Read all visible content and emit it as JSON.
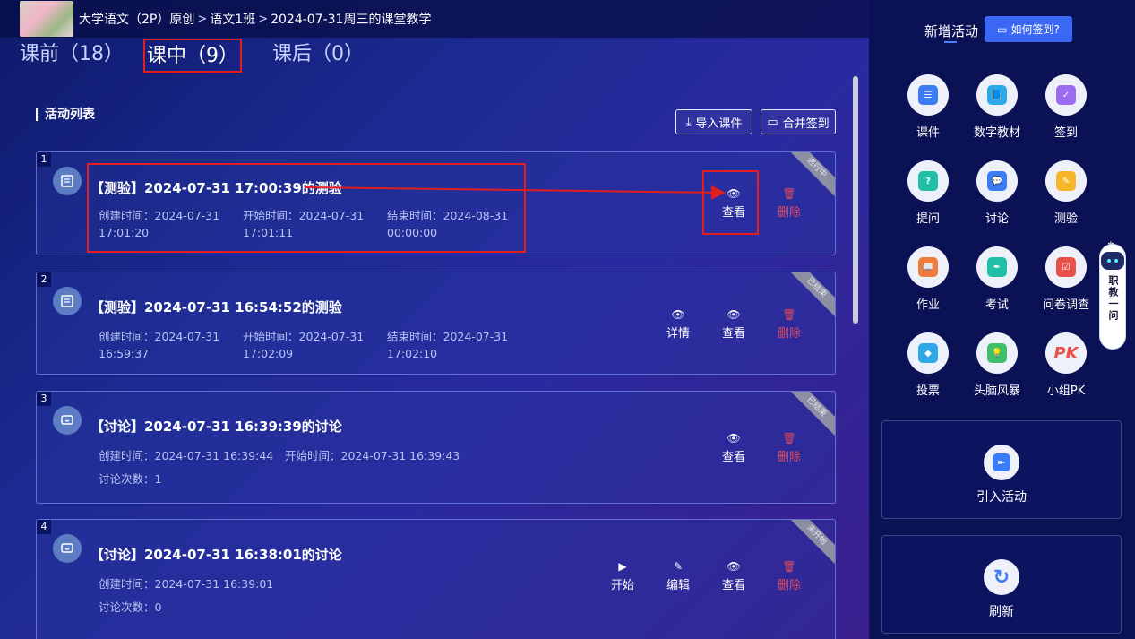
{
  "breadcrumb": {
    "course": "大学语文（2P）原创",
    "class": "语文1班",
    "lesson": "2024-07-31周三的课堂教学",
    "sep": ">"
  },
  "tabs": [
    {
      "label": "课前（18）"
    },
    {
      "label": "课中（9）"
    },
    {
      "label": "课后（0）"
    }
  ],
  "section_title": "活动列表",
  "header_buttons": {
    "import": "导入课件",
    "merge": "合并签到"
  },
  "activities": [
    {
      "index": "1",
      "status": "进行中",
      "title": "【测验】2024-07-31 17:00:39的测验",
      "created_label": "创建时间：2024-07-31",
      "created_time": "17:01:20",
      "start_label": "开始时间：2024-07-31",
      "start_time": "17:01:11",
      "end_label": "结束时间：2024-08-31",
      "end_time": "00:00:00",
      "actions": {
        "view": "查看",
        "delete": "删除"
      }
    },
    {
      "index": "2",
      "status": "已结束",
      "title": "【测验】2024-07-31 16:54:52的测验",
      "created_label": "创建时间：2024-07-31",
      "created_time": "16:59:37",
      "start_label": "开始时间：2024-07-31",
      "start_time": "17:02:09",
      "end_label": "结束时间：2024-07-31",
      "end_time": "17:02:10",
      "actions": {
        "detail": "详情",
        "view": "查看",
        "delete": "删除"
      }
    },
    {
      "index": "3",
      "status": "已结束",
      "title": "【讨论】2024-07-31 16:39:39的讨论",
      "created": "创建时间：2024-07-31 16:39:44",
      "start": "开始时间：2024-07-31 16:39:43",
      "count": "讨论次数：1",
      "actions": {
        "view": "查看",
        "delete": "删除"
      }
    },
    {
      "index": "4",
      "status": "未开始",
      "title": "【讨论】2024-07-31 16:38:01的讨论",
      "created": "创建时间：2024-07-31 16:39:01",
      "count": "讨论次数：0",
      "actions": {
        "start": "开始",
        "edit": "编辑",
        "view": "查看",
        "delete": "删除"
      }
    }
  ],
  "sidebar": {
    "title": "新增活动",
    "howto": "如何签到?",
    "items": [
      {
        "label": "课件",
        "icon": "courseware-icon",
        "color": "#3b7cf5"
      },
      {
        "label": "数字教材",
        "icon": "digital-textbook-icon",
        "color": "#2fa8e8"
      },
      {
        "label": "签到",
        "icon": "checkin-icon",
        "color": "#9b6cf0"
      },
      {
        "label": "提问",
        "icon": "question-icon",
        "color": "#1fbfa8"
      },
      {
        "label": "讨论",
        "icon": "discussion-icon",
        "color": "#3b7cf5"
      },
      {
        "label": "测验",
        "icon": "quiz-icon",
        "color": "#f5b62b"
      },
      {
        "label": "作业",
        "icon": "homework-icon",
        "color": "#f07b3b"
      },
      {
        "label": "考试",
        "icon": "exam-icon",
        "color": "#1fbfa8"
      },
      {
        "label": "问卷调查",
        "icon": "survey-icon",
        "color": "#e8504a"
      },
      {
        "label": "投票",
        "icon": "vote-icon",
        "color": "#2fa8e8"
      },
      {
        "label": "头脑风暴",
        "icon": "brainstorm-icon",
        "color": "#3fbf6a"
      },
      {
        "label": "小组PK",
        "icon": "group-pk-icon",
        "color": "#e8504a"
      }
    ],
    "import_activity": "引入活动",
    "refresh": "刷新"
  },
  "assistant": {
    "label": "职教一问"
  }
}
